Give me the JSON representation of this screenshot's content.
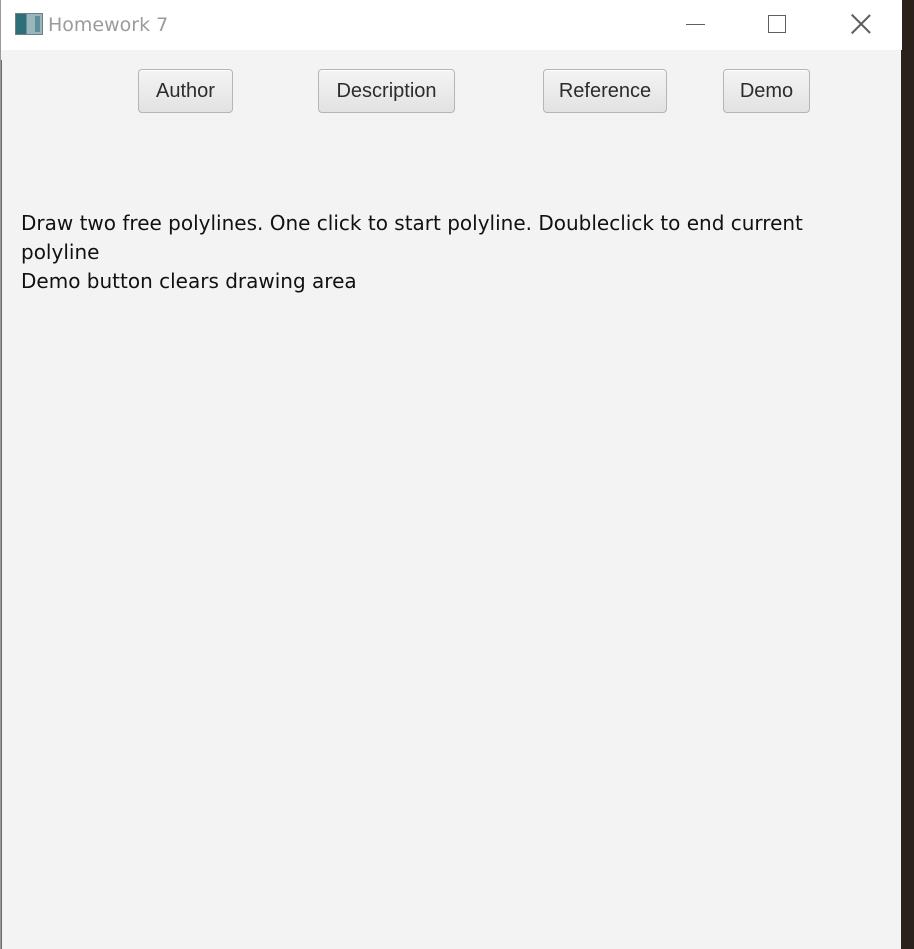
{
  "window": {
    "title": "Homework 7",
    "app_icon": "app-window-icon",
    "controls": {
      "minimize": "minimize-icon",
      "maximize": "maximize-icon",
      "close": "close-icon"
    }
  },
  "toolbar": {
    "author_label": "Author",
    "description_label": "Description",
    "reference_label": "Reference",
    "demo_label": "Demo"
  },
  "main": {
    "instructions": "Draw two free polylines. One click to start polyline. Doubleclick to end current polyline\nDemo button clears drawing area"
  },
  "colors": {
    "window_background": "#f3f3f3",
    "titlebar_background": "#ffffff",
    "desktop_background": "#2a211d",
    "button_border": "#b5b5b5",
    "text": "#111111"
  }
}
